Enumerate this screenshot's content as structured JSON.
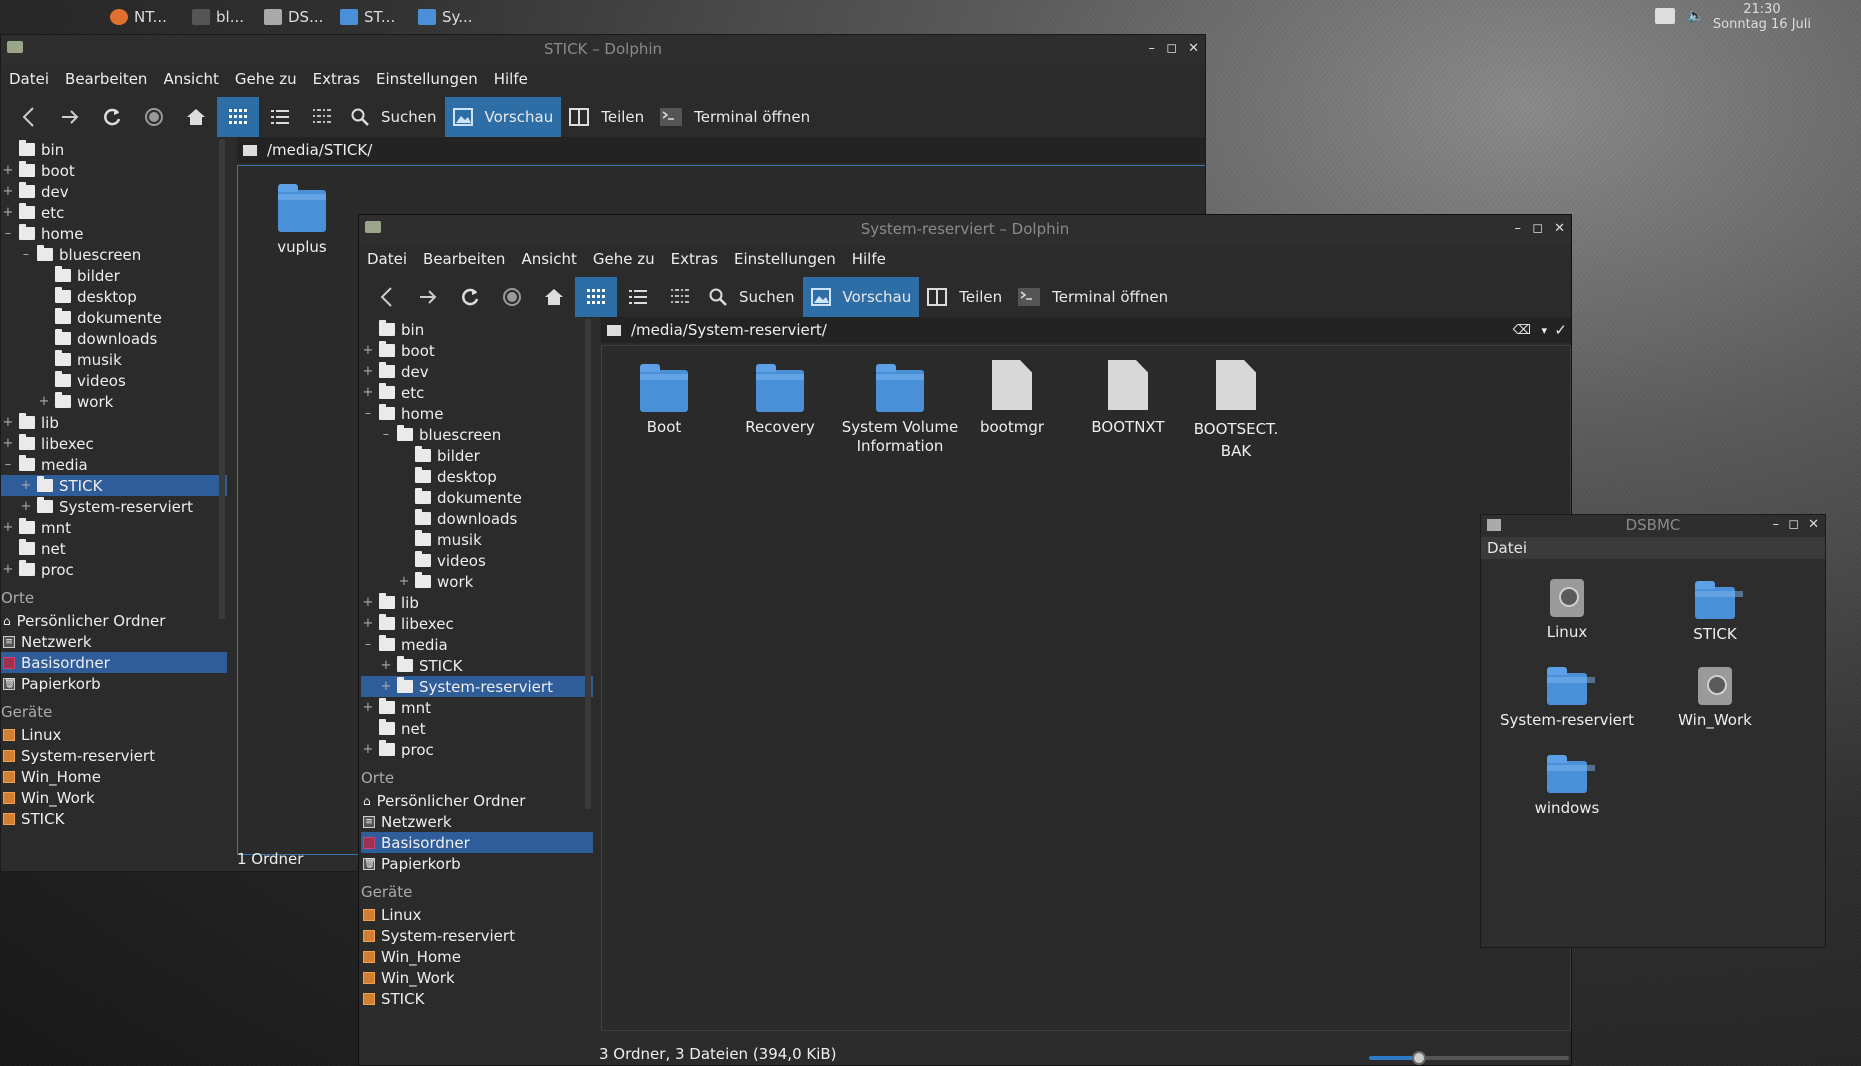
{
  "taskbar": {
    "tasks": [
      {
        "label": "NT...",
        "icon": "browser-icon",
        "color": "#e07030"
      },
      {
        "label": "bl...",
        "icon": "terminal-icon",
        "color": "#555555"
      },
      {
        "label": "DS...",
        "icon": "window-icon",
        "color": "#aaaaaa"
      },
      {
        "label": "ST...",
        "icon": "folder-icon",
        "color": "#4a90d9"
      },
      {
        "label": "Sy...",
        "icon": "folder-icon",
        "color": "#4a90d9"
      }
    ],
    "clock_time": "21:30",
    "clock_date": "Sonntag 16 Juli"
  },
  "menu": [
    "Datei",
    "Bearbeiten",
    "Ansicht",
    "Gehe zu",
    "Extras",
    "Einstellungen",
    "Hilfe"
  ],
  "toolbar": {
    "search": "Suchen",
    "preview": "Vorschau",
    "split": "Teilen",
    "terminal": "Terminal öffnen"
  },
  "window_stick": {
    "title": "STICK – Dolphin",
    "path": "/media/STICK/",
    "items": [
      {
        "name": "vuplus",
        "kind": "folder"
      }
    ],
    "status": "1 Ordner"
  },
  "window_sys": {
    "title": "System-reserviert – Dolphin",
    "path": "/media/System-reserviert/",
    "items": [
      {
        "name": "Boot",
        "kind": "folder"
      },
      {
        "name": "Recovery",
        "kind": "folder"
      },
      {
        "name": "System Volume Information",
        "kind": "folder"
      },
      {
        "name": "bootmgr",
        "kind": "file"
      },
      {
        "name": "BOOTNXT",
        "kind": "file"
      },
      {
        "name": "BOOTSECT. BAK",
        "kind": "file"
      }
    ],
    "status": "3 Ordner, 3 Dateien (394,0 KiB)",
    "zoom_level": 0.25
  },
  "tree": [
    "bin",
    "boot",
    "dev",
    "etc",
    "home",
    "bluescreen",
    "bilder",
    "desktop",
    "dokumente",
    "downloads",
    "musik",
    "videos",
    "work",
    "lib",
    "libexec",
    "media",
    "STICK",
    "System-reserviert",
    "mnt",
    "net",
    "proc"
  ],
  "places": {
    "heading": "Orte",
    "items": [
      "Persönlicher Ordner",
      "Netzwerk",
      "Basisordner",
      "Papierkorb"
    ]
  },
  "devices": {
    "heading": "Geräte",
    "items": [
      "Linux",
      "System-reserviert",
      "Win_Home",
      "Win_Work",
      "STICK"
    ]
  },
  "dsbmc": {
    "title": "DSBMC",
    "menu": "Datei",
    "items": [
      {
        "name": "Linux",
        "kind": "drive"
      },
      {
        "name": "STICK",
        "kind": "folder"
      },
      {
        "name": "System-reserviert",
        "kind": "folder"
      },
      {
        "name": "Win_Work",
        "kind": "drive"
      },
      {
        "name": "windows",
        "kind": "folder"
      }
    ]
  }
}
